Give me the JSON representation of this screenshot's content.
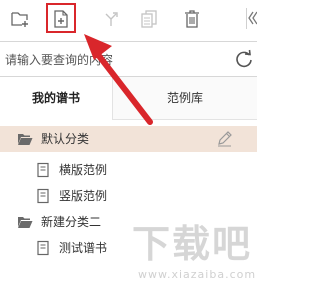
{
  "toolbar": {
    "buttons": [
      {
        "name": "new-folder-icon"
      },
      {
        "name": "new-file-icon",
        "highlighted": true
      },
      {
        "name": "move-icon",
        "disabled": true
      },
      {
        "name": "copy-icon",
        "disabled": true
      },
      {
        "name": "trash-icon"
      },
      {
        "name": "collapse-left-icon"
      }
    ],
    "highlight_color": "#d9262b"
  },
  "search": {
    "placeholder": "请输入要查询的内容",
    "value": "",
    "refresh_icon": "refresh-icon"
  },
  "tabs": [
    {
      "label": "我的谱书",
      "active": true
    },
    {
      "label": "范例库",
      "active": false
    }
  ],
  "tree": {
    "items": [
      {
        "label": "默认分类",
        "type": "folder",
        "selected": true,
        "has_edit": true
      },
      {
        "label": "横版范例",
        "type": "file"
      },
      {
        "label": "竖版范例",
        "type": "file"
      },
      {
        "label": "新建分类二",
        "type": "folder"
      },
      {
        "label": "测试谱书",
        "type": "file"
      }
    ],
    "selected_bg": "#f2e3d8"
  },
  "watermark": {
    "main": "下载吧",
    "sub": "www.xiazaiba.com"
  }
}
